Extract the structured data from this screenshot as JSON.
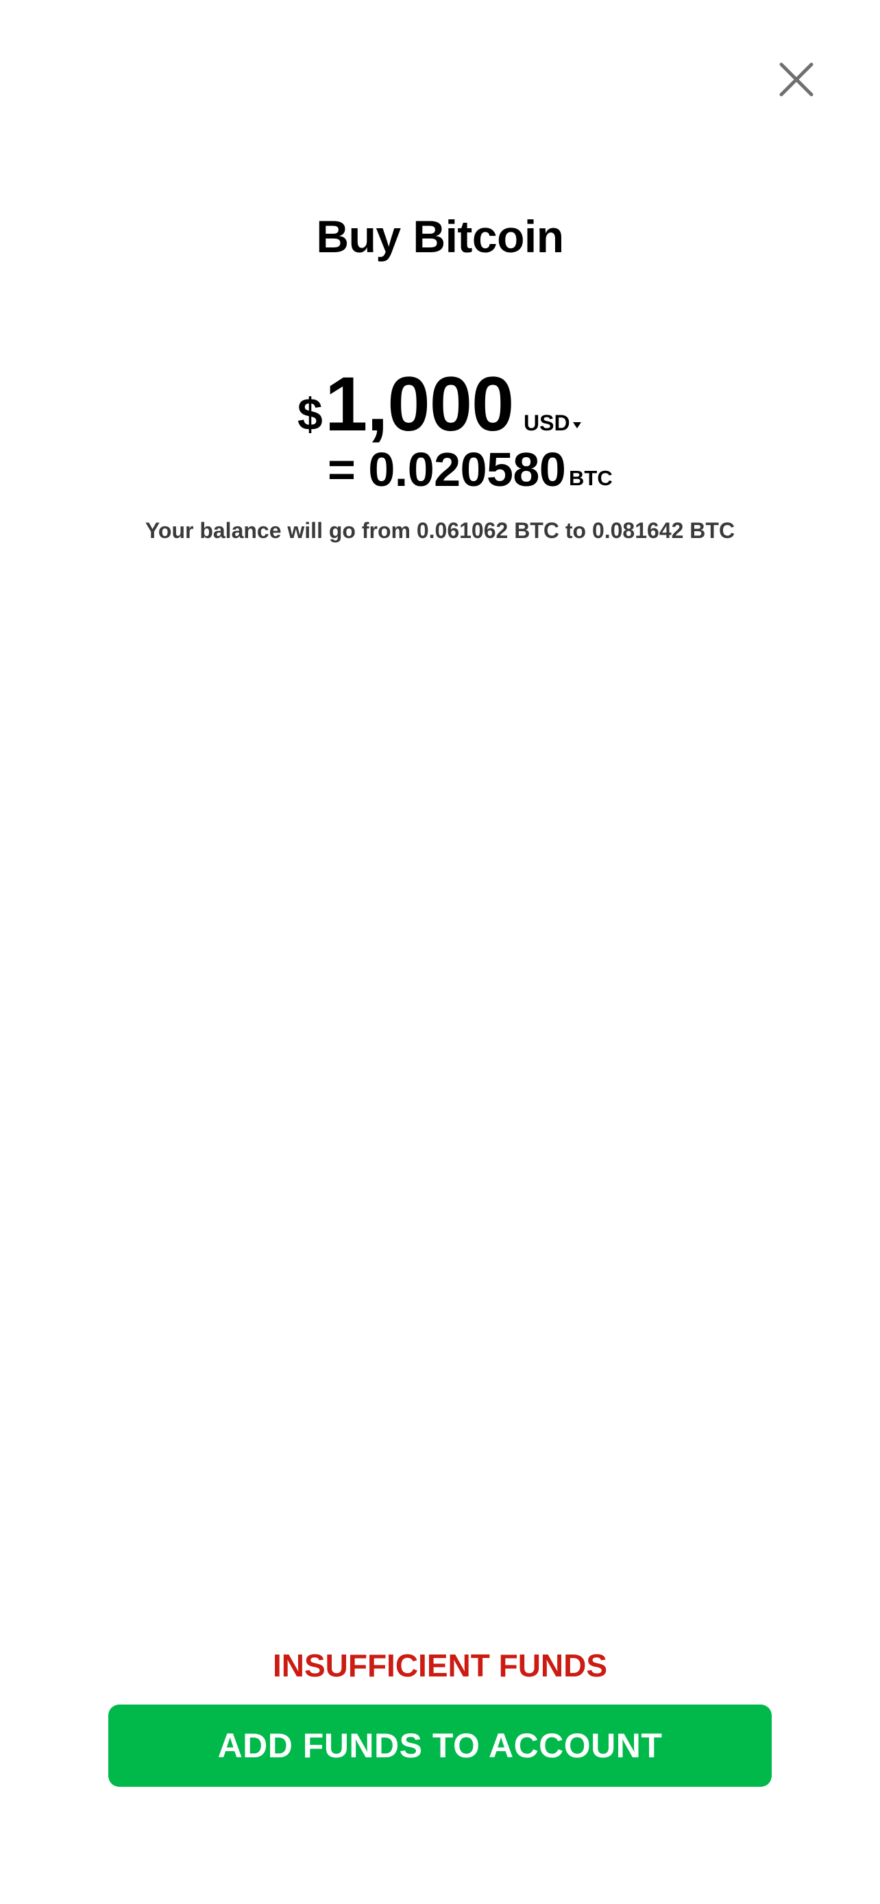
{
  "icons": {
    "close": "close-icon",
    "currency_caret": "chevron-down-icon"
  },
  "colors": {
    "accent_green": "#00b94a",
    "error_red": "#cc1b12",
    "text_primary": "#000000",
    "text_secondary": "#3a3a3a",
    "icon_gray": "#6f6f6f"
  },
  "header": {
    "title": "Buy Bitcoin"
  },
  "amount": {
    "symbol": "$",
    "value": "1,000",
    "currency": "USD"
  },
  "conversion": {
    "value": "= 0.020580",
    "unit": "BTC"
  },
  "balance_note": "Your balance will go from 0.061062 BTC to 0.081642 BTC",
  "warning": "INSUFFICIENT FUNDS",
  "primary_action": {
    "label": "ADD FUNDS TO ACCOUNT"
  }
}
